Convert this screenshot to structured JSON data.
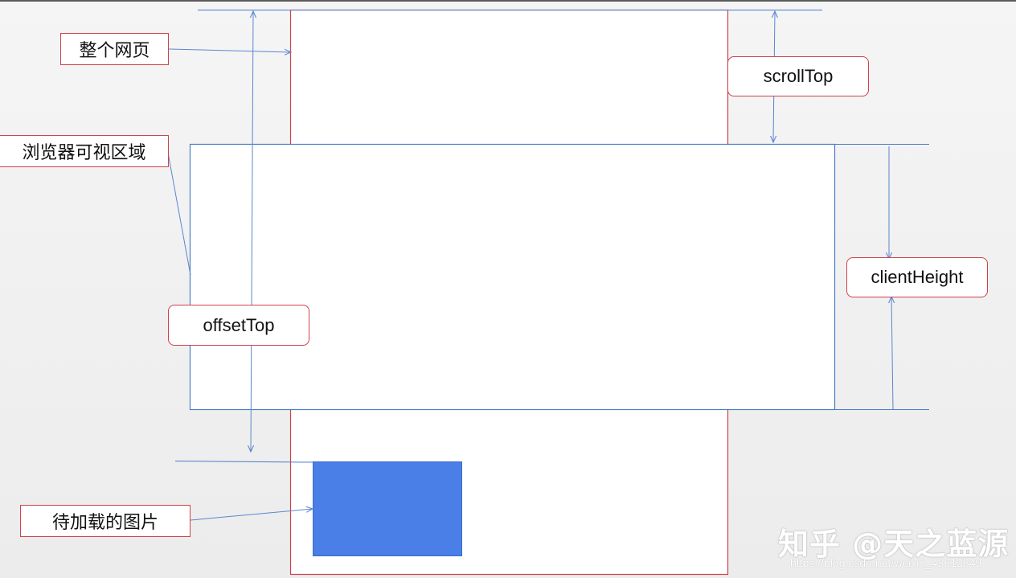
{
  "labels": {
    "whole_page": "整个网页",
    "viewport": "浏览器可视区域",
    "scroll_top": "scrollTop",
    "client_height": "clientHeight",
    "offset_top": "offsetTop",
    "pending_image": "待加载的图片"
  },
  "watermark": {
    "text": "知乎 @天之蓝源",
    "url": "https://blog.csdn.net/weixin_43613849"
  },
  "colors": {
    "page_border": "#d0414a",
    "viewport_border": "#4a7cc8",
    "arrow": "#5b86d0",
    "image_fill": "#4a7fe8"
  }
}
